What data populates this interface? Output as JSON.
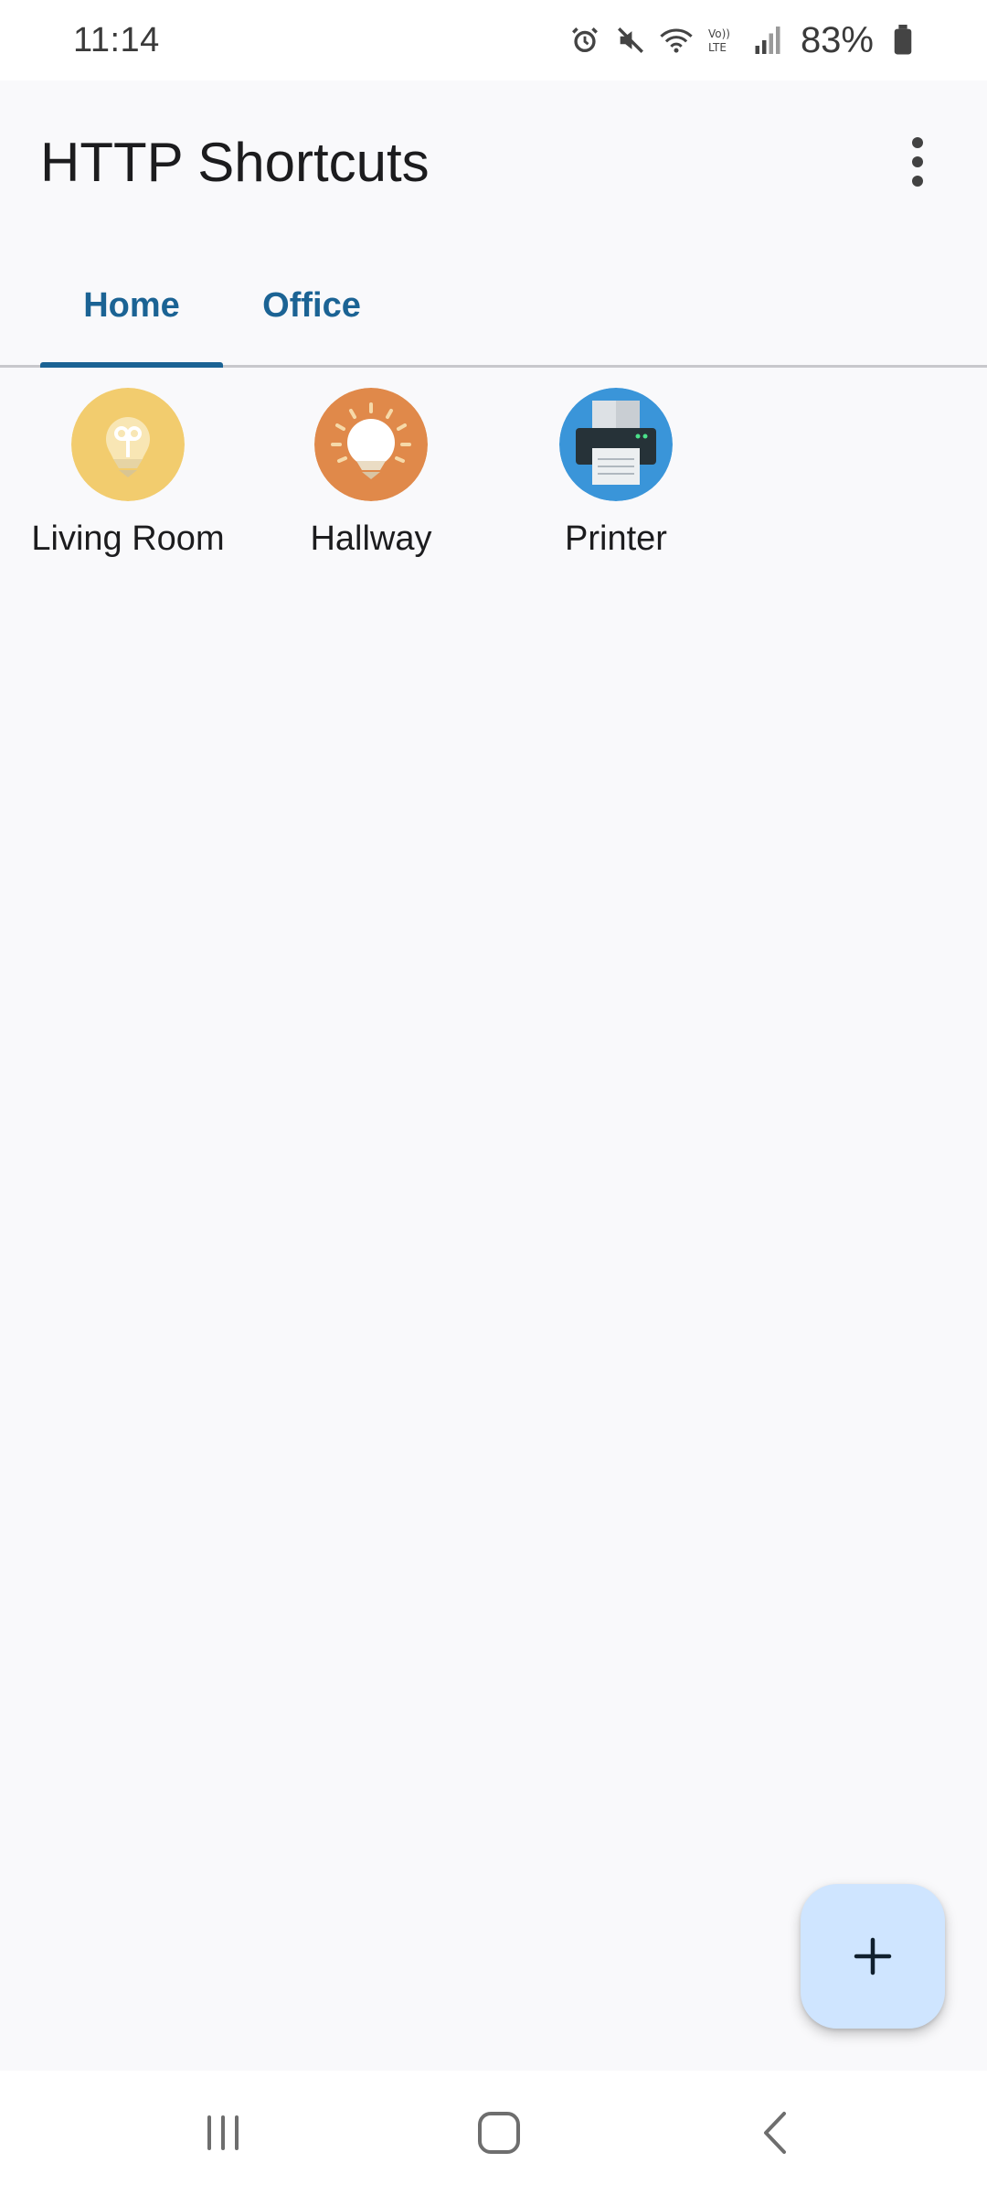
{
  "status_bar": {
    "time": "11:14",
    "battery": "83%",
    "icons": [
      "alarm-icon",
      "mute-icon",
      "wifi-icon",
      "volte-icon",
      "signal-icon",
      "battery-icon"
    ]
  },
  "app_bar": {
    "title": "HTTP Shortcuts",
    "menu_icon": "more-vert-icon"
  },
  "tabs": [
    {
      "label": "Home",
      "selected": true
    },
    {
      "label": "Office",
      "selected": false
    }
  ],
  "shortcuts": [
    {
      "label": "Living Room",
      "icon": "lightbulb-off-icon",
      "icon_color": "#f2cc6e"
    },
    {
      "label": "Hallway",
      "icon": "lightbulb-on-icon",
      "icon_color": "#e0894a"
    },
    {
      "label": "Printer",
      "icon": "printer-icon",
      "icon_color": "#3a95d9"
    }
  ],
  "fab": {
    "icon": "plus-icon",
    "color": "#cfe5ff"
  },
  "nav_bar": {
    "buttons": [
      "recents-icon",
      "home-icon",
      "back-icon"
    ]
  },
  "colors": {
    "accent": "#1b6394",
    "background": "#f9f9fb"
  }
}
